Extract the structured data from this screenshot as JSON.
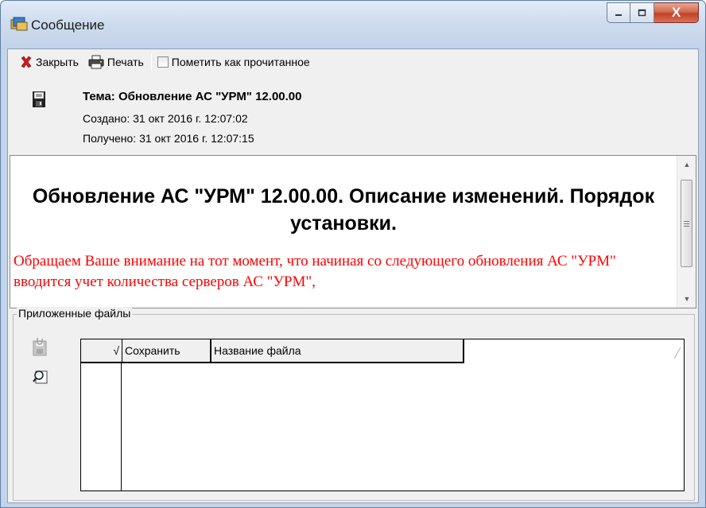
{
  "window": {
    "title": "Сообщение",
    "close_glyph": "X",
    "icons": [
      "message-app-icon",
      "minimize-icon",
      "maximize-icon",
      "close-icon"
    ]
  },
  "toolbar": {
    "close_label": "Закрыть",
    "print_label": "Печать",
    "mark_read_label": "Пометить как прочитанное",
    "mark_read_checked": false,
    "icons": [
      "red-x-icon",
      "printer-icon"
    ]
  },
  "message": {
    "subject": "Тема: Обновление АС \"УРМ\" 12.00.00",
    "created": "Создано: 31 окт 2016 г. 12:07:02",
    "received": "Получено: 31 окт 2016 г. 12:07:15",
    "icon": "save-disk-icon"
  },
  "body": {
    "heading": "Обновление АС \"УРМ\" 12.00.00. Описание изменений. Порядок установки.",
    "notice": "Обращаем Ваше внимание на тот момент, что начиная со следующего обновления АС \"УРМ\" вводится учет количества серверов АС \"УРМ\",",
    "notice_color": "#ff0000"
  },
  "attachments": {
    "legend": "Приложенные файлы",
    "columns": [
      "Сохранить",
      "Название файла"
    ],
    "indicator_glyph": "√",
    "rows": [],
    "icons": [
      "save-attachment-icon",
      "preview-icon"
    ]
  }
}
